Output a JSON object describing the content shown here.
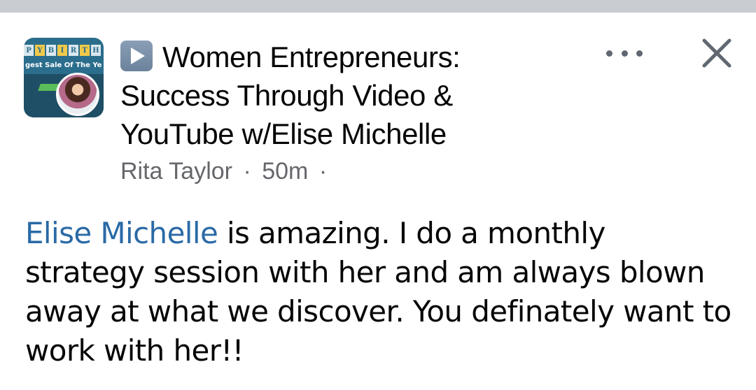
{
  "post": {
    "group_thumbnail": {
      "banner_letters": [
        "P",
        "Y",
        "B",
        "I",
        "R",
        "T",
        "H"
      ],
      "banner_text": "gest Sale Of The Ye"
    },
    "title": "Women Entrepreneurs: Success Through Video & YouTube w/Elise Michelle",
    "author": "Rita Taylor",
    "separator": "·",
    "timestamp": "50m",
    "trailing_separator": "·",
    "body": {
      "mention": "Elise Michelle",
      "text": " is amazing.  I do a monthly strategy session with her and am always blown away at what we discover.  You definately want to work with her!!"
    },
    "icons": {
      "title_prefix": "play-button-icon",
      "more": "more-options-icon",
      "close": "close-icon"
    },
    "colors": {
      "mention": "#2a6aa6",
      "meta": "#65676b",
      "text": "#050505",
      "top_strip": "#c9ccd1"
    }
  }
}
